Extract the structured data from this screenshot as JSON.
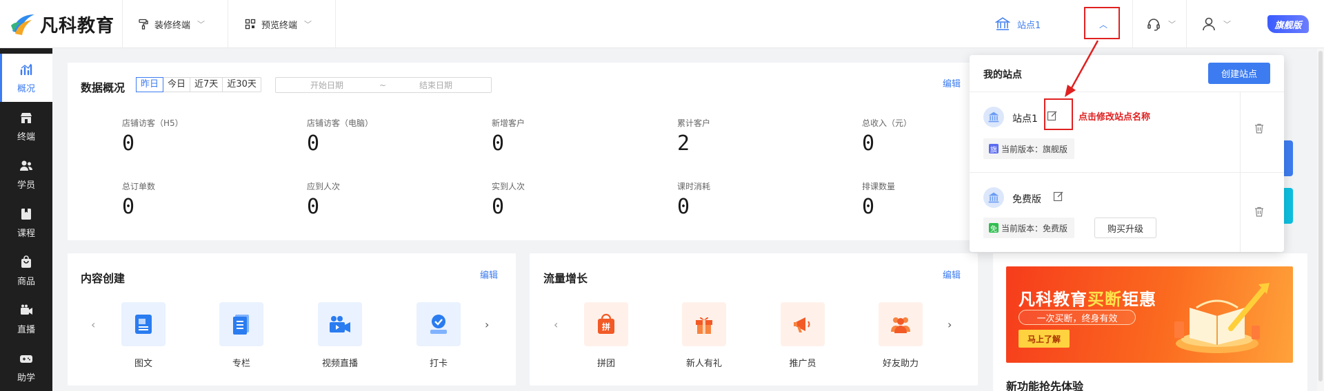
{
  "header": {
    "logo_text": "凡科教育",
    "nav": [
      {
        "label": "装修终端",
        "icon": "paint-roller-icon"
      },
      {
        "label": "预览终端",
        "icon": "qr-grid-icon"
      }
    ],
    "site_selector": "站点1",
    "vip_label": "旗舰版"
  },
  "sidebar": {
    "items": [
      {
        "label": "概况",
        "icon": "chart-icon",
        "active": true
      },
      {
        "label": "终端",
        "icon": "store-icon"
      },
      {
        "label": "学员",
        "icon": "users-icon"
      },
      {
        "label": "课程",
        "icon": "book-icon"
      },
      {
        "label": "商品",
        "icon": "bag-icon"
      },
      {
        "label": "直播",
        "icon": "video-icon"
      },
      {
        "label": "助学",
        "icon": "gamepad-icon"
      }
    ]
  },
  "overview": {
    "title": "数据概况",
    "edit": "编辑",
    "ranges": [
      "昨日",
      "今日",
      "近7天",
      "近30天"
    ],
    "active_range": "昨日",
    "start_placeholder": "开始日期",
    "to": "~",
    "end_placeholder": "结束日期",
    "stats": [
      {
        "label": "店铺访客（H5）",
        "value": "0"
      },
      {
        "label": "店铺访客（电脑）",
        "value": "0"
      },
      {
        "label": "新增客户",
        "value": "0"
      },
      {
        "label": "累计客户",
        "value": "2"
      },
      {
        "label": "总收入（元）",
        "value": "0"
      },
      {
        "label": "总订单数",
        "value": "0"
      },
      {
        "label": "应到人次",
        "value": "0"
      },
      {
        "label": "实到人次",
        "value": "0"
      },
      {
        "label": "课时消耗",
        "value": "0"
      },
      {
        "label": "排课数量",
        "value": "0"
      }
    ]
  },
  "content": {
    "title": "内容创建",
    "edit": "编辑",
    "tiles": [
      {
        "label": "图文",
        "icon": "article-icon"
      },
      {
        "label": "专栏",
        "icon": "column-icon"
      },
      {
        "label": "视频直播",
        "icon": "camera-icon"
      },
      {
        "label": "打卡",
        "icon": "checkin-icon"
      }
    ]
  },
  "traffic": {
    "title": "流量增长",
    "edit": "编辑",
    "tiles": [
      {
        "label": "拼团",
        "icon": "group-buy-icon"
      },
      {
        "label": "新人有礼",
        "icon": "gift-icon"
      },
      {
        "label": "推广员",
        "icon": "megaphone-icon"
      },
      {
        "label": "好友助力",
        "icon": "friends-icon"
      }
    ]
  },
  "banner": {
    "headline_white": "凡科教育",
    "headline_yellow": "买断",
    "headline_tail": "钜惠",
    "pill": "一次买断，终身有效",
    "cta": "马上了解"
  },
  "new_features": "新功能抢先体验",
  "dropdown": {
    "title": "我的站点",
    "create": "创建站点",
    "sites": [
      {
        "name": "站点1",
        "version": "当前版本：旗舰版",
        "badge": "旗",
        "badge_color": "#5b6cf0"
      },
      {
        "name": "免费版",
        "version": "当前版本：免费版",
        "badge": "免",
        "badge_color": "#2fbf4f",
        "upgrade": "购买升级"
      }
    ]
  },
  "annotation": "点击修改站点名称",
  "colors": {
    "accent": "#3d7cf0",
    "annotation": "#e02020",
    "sidebar": "#1f1f1f"
  }
}
